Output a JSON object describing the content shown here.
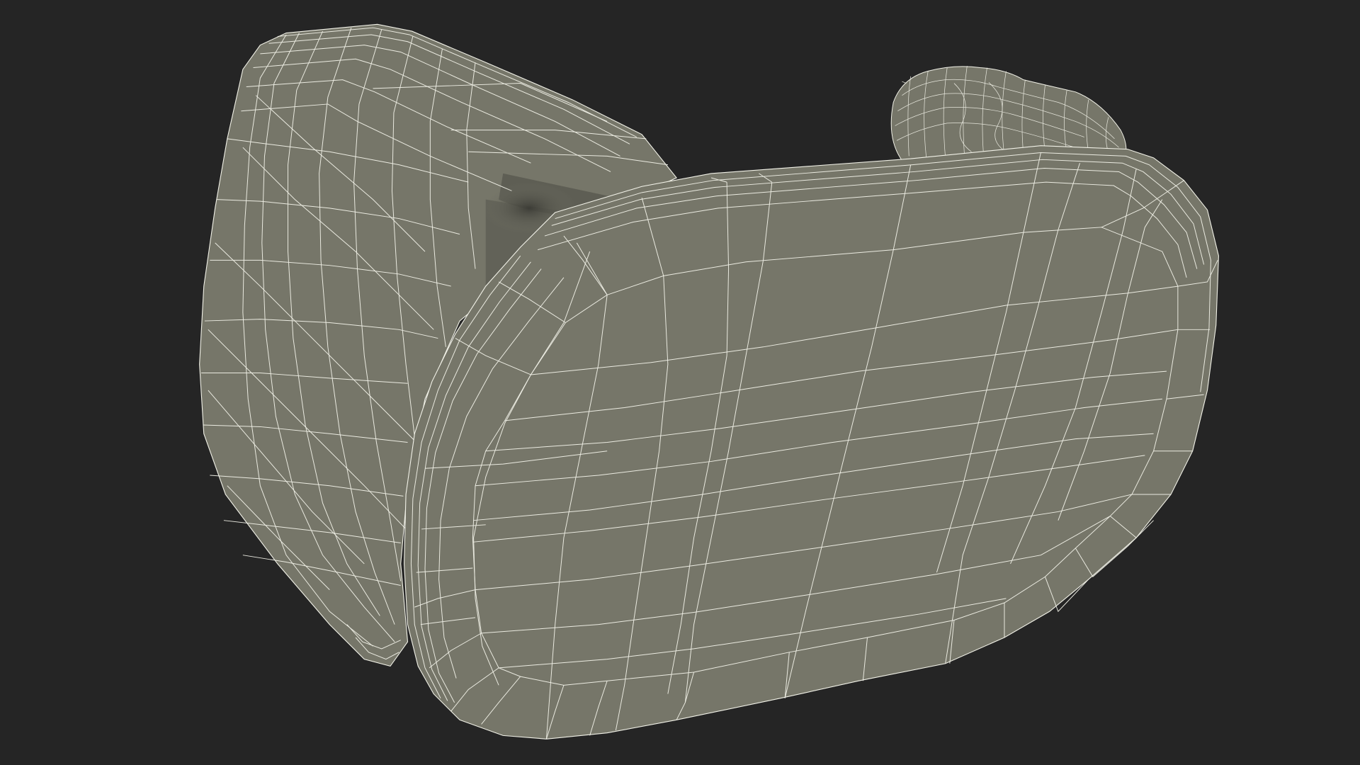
{
  "scene": {
    "subject": "wireframe-3d-model",
    "colors": {
      "background": "#252525",
      "surface": "#767669",
      "surface_dark": "#5f5f56",
      "shadow": "#3e3e38",
      "wire": "#f2f2e8"
    }
  }
}
